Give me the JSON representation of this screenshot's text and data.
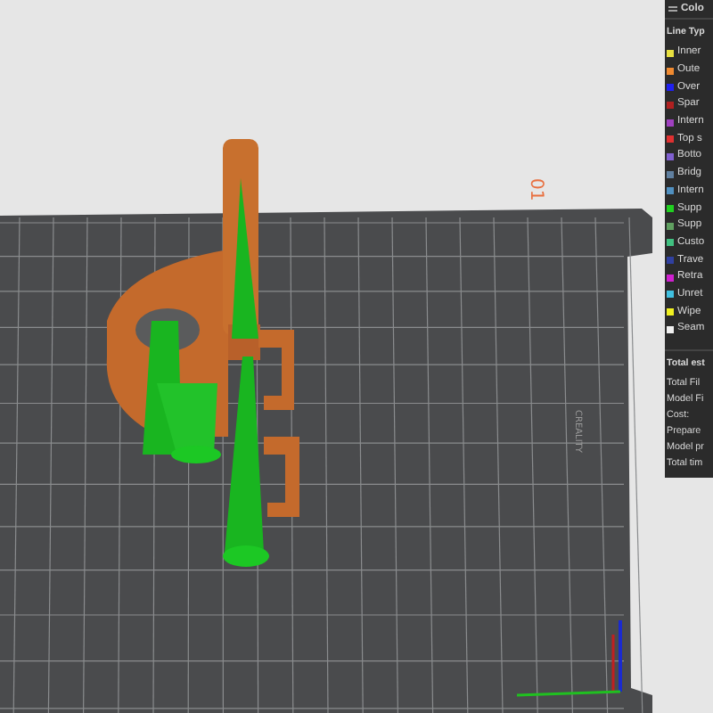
{
  "viewport": {
    "plate_label": "CREALITY",
    "plate_number": "01"
  },
  "legend_panel": {
    "title": "Colo",
    "section": "Line Typ",
    "line_types": [
      {
        "label": "Inner",
        "color": "#e8e040"
      },
      {
        "label": "Oute",
        "color": "#f08a30"
      },
      {
        "label": "Over",
        "color": "#2020f0"
      },
      {
        "label": "Spar",
        "color": "#b02020"
      },
      {
        "label": "Intern",
        "color": "#a040c0"
      },
      {
        "label": "Top s",
        "color": "#e03030"
      },
      {
        "label": "Botto",
        "color": "#8060d0"
      },
      {
        "label": "Bridg",
        "color": "#6080a0"
      },
      {
        "label": "Intern",
        "color": "#5090c0"
      },
      {
        "label": "Supp",
        "color": "#20d020"
      },
      {
        "label": "Supp",
        "color": "#60a060"
      },
      {
        "label": "Custo",
        "color": "#40c080"
      },
      {
        "label": "Trave",
        "color": "#3040a0"
      },
      {
        "label": "Retra",
        "color": "#d020d0"
      },
      {
        "label": "Unret",
        "color": "#40c0e0"
      },
      {
        "label": "Wipe",
        "color": "#f0f020"
      },
      {
        "label": "Seam",
        "color": "#f0f0f0"
      }
    ],
    "summary_title": "Total est",
    "summary": [
      "Total Fil",
      "Model Fi",
      "Cost:",
      "Prepare",
      "Model pr",
      "Total tim"
    ]
  }
}
